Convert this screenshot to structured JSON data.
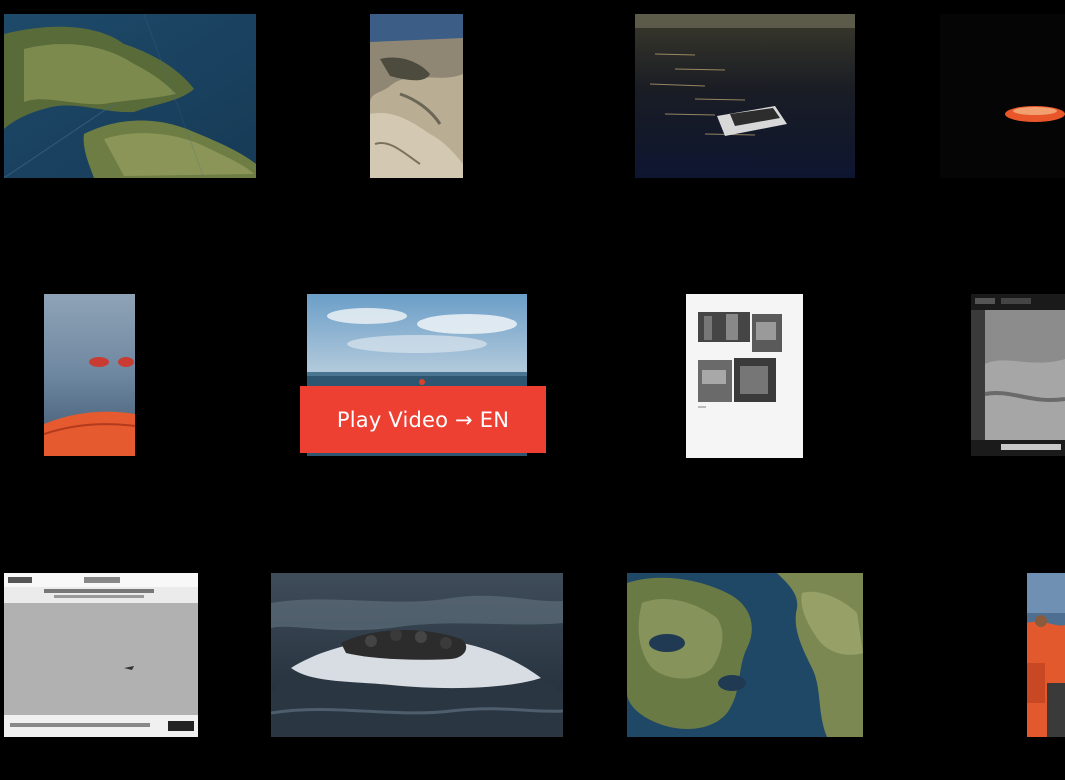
{
  "play_button": {
    "label": "Play Video → EN",
    "color": "#ee3f33"
  },
  "thumbnails": [
    {
      "name": "satellite-coastline-map"
    },
    {
      "name": "aerial-rocky-shore"
    },
    {
      "name": "boat-at-sunset-sea"
    },
    {
      "name": "orange-dinghy-at-night"
    },
    {
      "name": "sea-with-orange-raft"
    },
    {
      "name": "sky-over-sea"
    },
    {
      "name": "document-with-photos"
    },
    {
      "name": "thermal-surveillance-screen"
    },
    {
      "name": "radar-screen-grey"
    },
    {
      "name": "capsized-boat-in-waves"
    },
    {
      "name": "satellite-island-map"
    },
    {
      "name": "people-in-life-vests"
    }
  ],
  "colors": {
    "background": "#000000"
  }
}
